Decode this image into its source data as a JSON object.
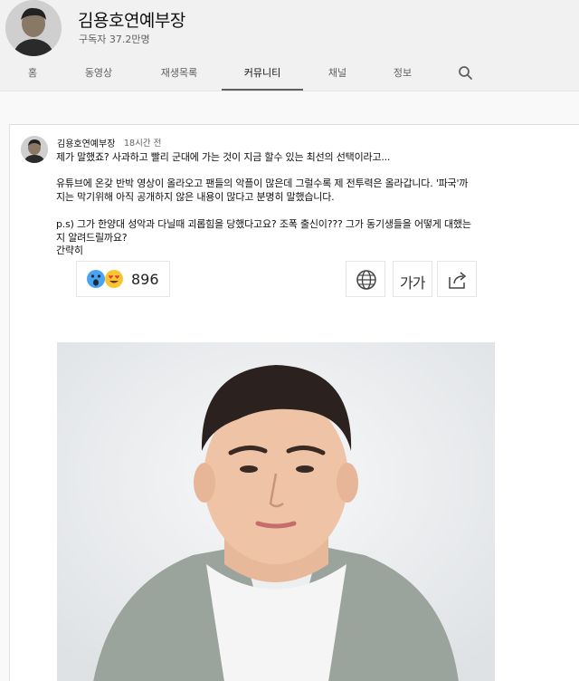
{
  "channel": {
    "name": "김용호연예부장",
    "subscribers": "구독자 37.2만명"
  },
  "tabs": [
    {
      "label": "홈"
    },
    {
      "label": "동영상"
    },
    {
      "label": "재생목록"
    },
    {
      "label": "커뮤니티"
    },
    {
      "label": "채널"
    },
    {
      "label": "정보"
    }
  ],
  "post": {
    "author": "김용호연예부장",
    "time": "18시간 전",
    "lines": [
      "제가 말했죠? 사과하고 빨리 군대에 가는 것이 지금  할수 있는 최선의 선택이라고...",
      "유튜브에 온갖 반박 영상이 올라오고 팬들의 악플이 많은데 그럴수록 제 전투력은 올라갑니다. '파국'까",
      "지는 막기위해 아직 공개하지 않은 내용이 많다고 분명히 말했습니다.",
      "p.s) 그가 한양대 성악과 다닐때 괴롭힘을 당했다고요? 조폭 출신이??? 그가 동기생들을 어떻게 대했는",
      "지 알려드릴까요?",
      "간략히"
    ]
  },
  "reactions": {
    "count": "896"
  },
  "toolbar": {
    "font_label": "가가"
  },
  "icons": [
    "search-icon",
    "globe-icon",
    "share-icon",
    "surprised-face-icon",
    "heart-eyes-face-icon"
  ]
}
